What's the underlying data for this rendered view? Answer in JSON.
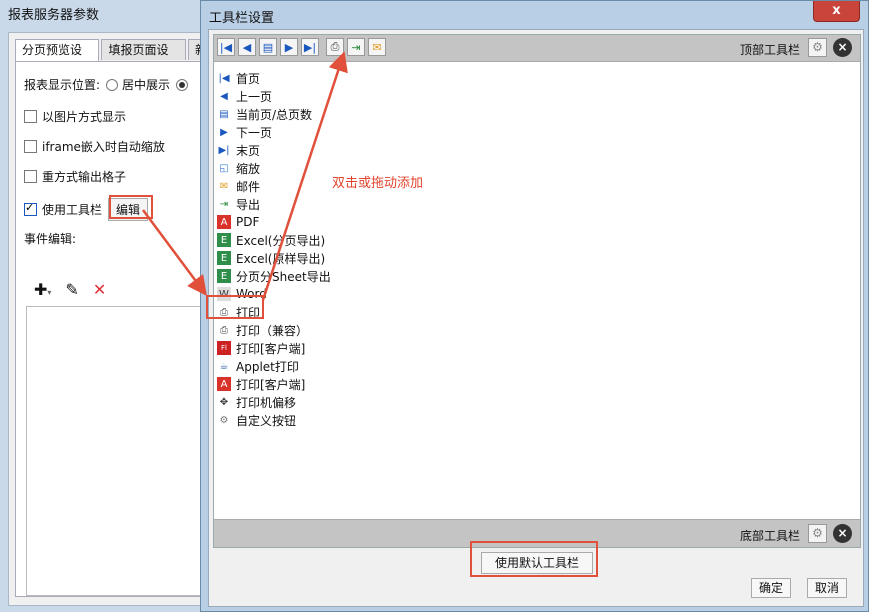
{
  "back_dialog": {
    "title": "报表服务器参数",
    "tabs": [
      "分页预览设置",
      "填报页面设置",
      "新"
    ],
    "display_position_label": "报表显示位置:",
    "center_option": "居中展示",
    "show_as_image": "以图片方式显示",
    "iframe_zoom": "iframe嵌入时自动缩放",
    "repeat_output": "重方式输出格子",
    "use_toolbar": "使用工具栏",
    "edit_button": "编辑",
    "event_edit_label": "事件编辑:"
  },
  "front_dialog": {
    "title": "工具栏设置",
    "close_glyph": "x",
    "top_toolbar_label": "顶部工具栏",
    "bottom_toolbar_label": "底部工具栏",
    "hint": "双击或拖动添加",
    "default_button": "使用默认工具栏",
    "ok_button": "确定",
    "cancel_button": "取消",
    "items": [
      {
        "label": "首页",
        "icon": "first-page-icon"
      },
      {
        "label": "上一页",
        "icon": "prev-page-icon"
      },
      {
        "label": "当前页/总页数",
        "icon": "page-count-icon"
      },
      {
        "label": "下一页",
        "icon": "next-page-icon"
      },
      {
        "label": "末页",
        "icon": "last-page-icon"
      },
      {
        "label": "缩放",
        "icon": "zoom-icon"
      },
      {
        "label": "邮件",
        "icon": "mail-icon"
      },
      {
        "label": "导出",
        "icon": "export-icon"
      },
      {
        "label": "PDF",
        "icon": "pdf-icon"
      },
      {
        "label": "Excel(分页导出)",
        "icon": "excel-icon"
      },
      {
        "label": "Excel(原样导出)",
        "icon": "excel-icon"
      },
      {
        "label": "分页分Sheet导出",
        "icon": "excel-icon"
      },
      {
        "label": "Word",
        "icon": "word-icon"
      },
      {
        "label": "打印",
        "icon": "print-icon"
      },
      {
        "label": "打印（兼容）",
        "icon": "print-icon"
      },
      {
        "label": "打印[客户端]",
        "icon": "flash-print-icon"
      },
      {
        "label": "Applet打印",
        "icon": "applet-icon"
      },
      {
        "label": "打印[客户端]",
        "icon": "pdf-print-icon"
      },
      {
        "label": "打印机偏移",
        "icon": "move-icon"
      },
      {
        "label": "自定义按钮",
        "icon": "gear-icon"
      }
    ]
  },
  "colors": {
    "accent_red": "#e0452e",
    "icon_blue": "#1a58c0"
  }
}
